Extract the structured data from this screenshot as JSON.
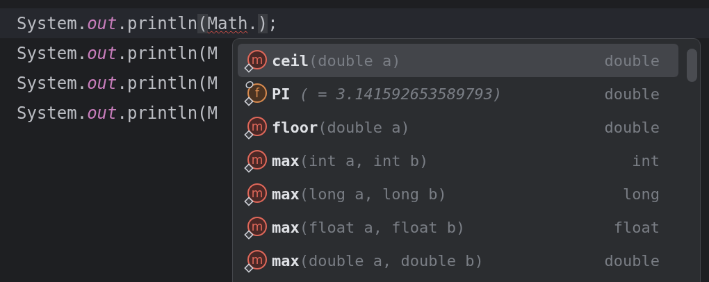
{
  "editor": {
    "lines": [
      {
        "current": true,
        "parts": [
          {
            "text": "System.",
            "kind": "plain"
          },
          {
            "text": "out",
            "kind": "static"
          },
          {
            "text": ".println",
            "kind": "plain"
          },
          {
            "text": "(",
            "kind": "brace-match"
          },
          {
            "text": "Math",
            "kind": "error"
          },
          {
            "text": ".",
            "kind": "plain"
          },
          {
            "text": ")",
            "kind": "brace-match"
          },
          {
            "text": ";",
            "kind": "plain"
          }
        ]
      },
      {
        "current": false,
        "parts": [
          {
            "text": "System.",
            "kind": "plain"
          },
          {
            "text": "out",
            "kind": "static"
          },
          {
            "text": ".println(M",
            "kind": "plain"
          }
        ]
      },
      {
        "current": false,
        "parts": [
          {
            "text": "System.",
            "kind": "plain"
          },
          {
            "text": "out",
            "kind": "static"
          },
          {
            "text": ".println(M",
            "kind": "plain"
          }
        ]
      },
      {
        "current": false,
        "parts": [
          {
            "text": "System.",
            "kind": "plain"
          },
          {
            "text": "out",
            "kind": "static"
          },
          {
            "text": ".println(M",
            "kind": "plain"
          }
        ]
      }
    ]
  },
  "completion": {
    "items": [
      {
        "kind": "method",
        "badge": "m",
        "name": "ceil",
        "params": "(double a)",
        "type": "double",
        "selected": true
      },
      {
        "kind": "field",
        "badge": "f",
        "name": "PI",
        "params": " ( = 3.141592653589793)",
        "type": "double",
        "selected": false
      },
      {
        "kind": "method",
        "badge": "m",
        "name": "floor",
        "params": "(double a)",
        "type": "double",
        "selected": false
      },
      {
        "kind": "method",
        "badge": "m",
        "name": "max",
        "params": "(int a, int b)",
        "type": "int",
        "selected": false
      },
      {
        "kind": "method",
        "badge": "m",
        "name": "max",
        "params": "(long a, long b)",
        "type": "long",
        "selected": false
      },
      {
        "kind": "method",
        "badge": "m",
        "name": "max",
        "params": "(float a, float b)",
        "type": "float",
        "selected": false
      },
      {
        "kind": "method",
        "badge": "m",
        "name": "max",
        "params": "(double a, double b)",
        "type": "double",
        "selected": false
      }
    ]
  }
}
